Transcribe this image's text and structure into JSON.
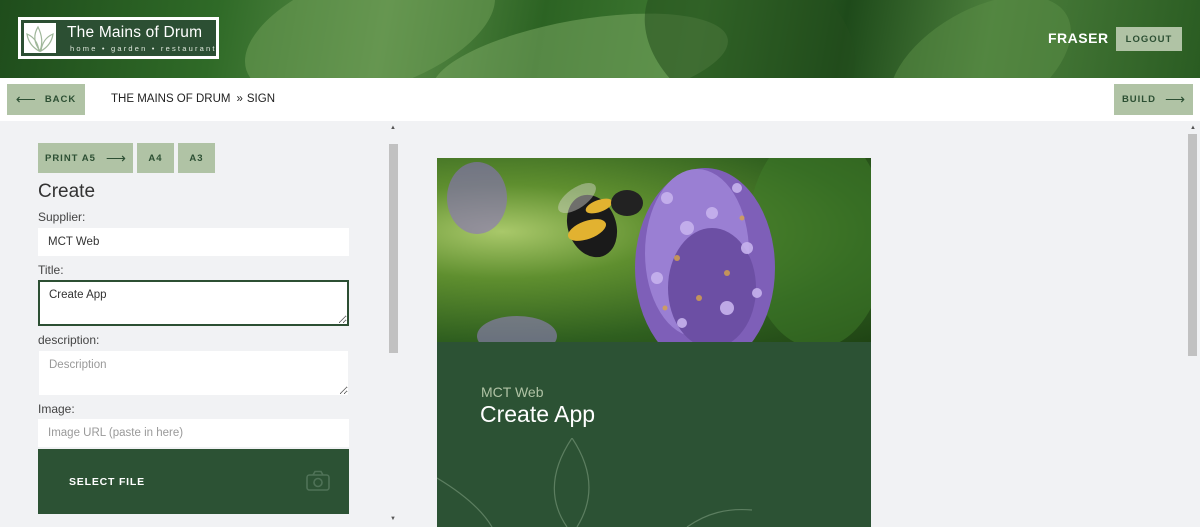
{
  "header": {
    "logo_title": "The Mains of Drum",
    "logo_subtitle": "home • garden • restaurant",
    "user_name": "FRASER",
    "logout_label": "LOGOUT"
  },
  "nav": {
    "back_label": "BACK",
    "breadcrumb": [
      "THE MAINS OF DRUM",
      "»",
      "SIGN"
    ],
    "build_label": "BUILD"
  },
  "print_options": {
    "print_a5_label": "PRINT A5",
    "a4_label": "A4",
    "a3_label": "A3"
  },
  "form": {
    "heading": "Create",
    "supplier": {
      "label": "Supplier:",
      "value": "MCT Web"
    },
    "title": {
      "label": "Title:",
      "value": "Create App"
    },
    "description": {
      "label": "description:",
      "value": "",
      "placeholder": "Description"
    },
    "image": {
      "label": "Image:",
      "value": "",
      "placeholder": "Image URL (paste in here)"
    },
    "select_file_label": "SELECT FILE"
  },
  "preview": {
    "supplier": "MCT Web",
    "title": "Create App"
  },
  "colors": {
    "accent": "#b0c3a5",
    "brand_dark": "#2c5234",
    "background": "#f1f2f4"
  },
  "icons": {
    "back": "arrow-left-icon",
    "build": "arrow-right-icon",
    "print": "arrow-right-icon",
    "camera": "camera-icon",
    "logo": "leaf-logo-icon"
  }
}
